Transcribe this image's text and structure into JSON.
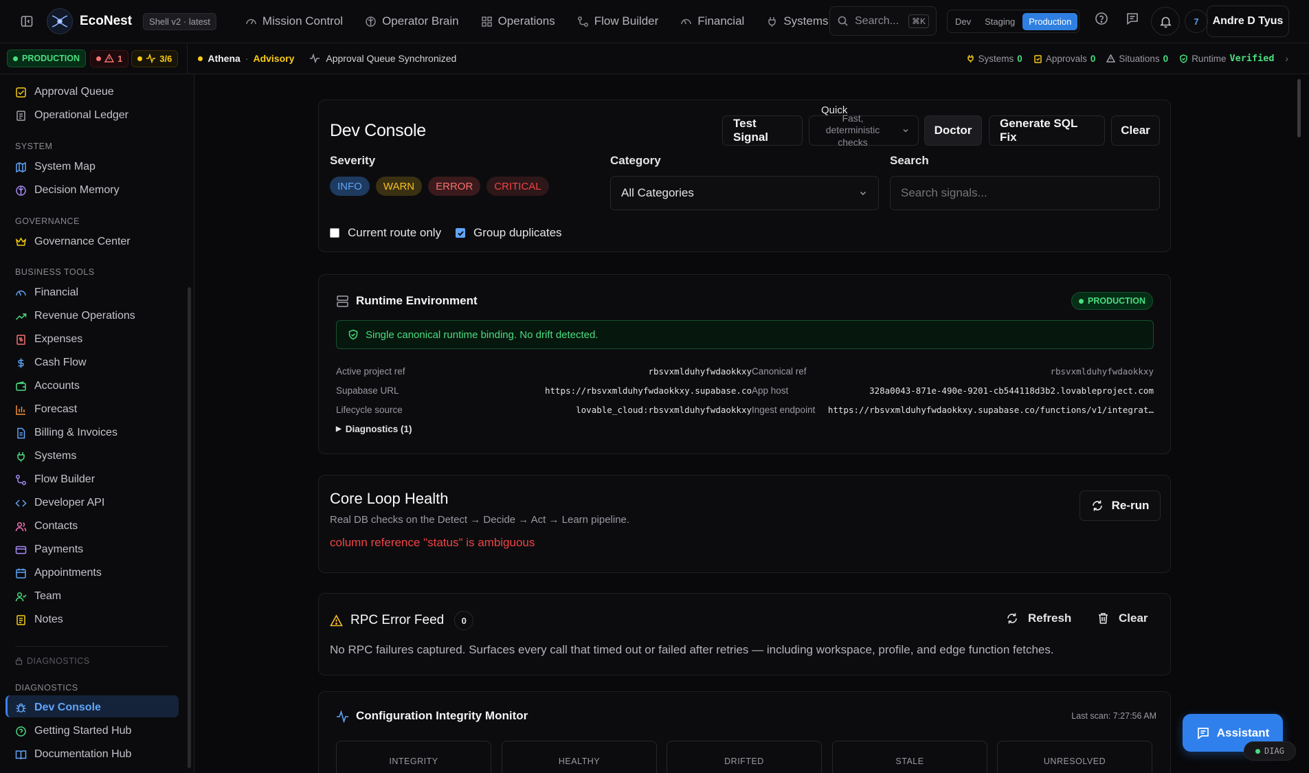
{
  "topbar": {
    "brand": "EcoNest",
    "shell_tag": "Shell v2 · latest",
    "nav": [
      {
        "label": "Mission Control",
        "icon": "gauge-icon"
      },
      {
        "label": "Operator Brain",
        "icon": "brain-icon"
      },
      {
        "label": "Operations",
        "icon": "grid-icon"
      },
      {
        "label": "Flow Builder",
        "icon": "flow-icon"
      },
      {
        "label": "Financial",
        "icon": "gauge-icon"
      },
      {
        "label": "Systems",
        "icon": "plug-icon"
      }
    ],
    "search_placeholder": "Search...",
    "search_shortcut": "⌘K",
    "envs": [
      "Dev",
      "Staging",
      "Production"
    ],
    "active_env": "Production",
    "notification_count": "7",
    "user": "Andre D Tyus"
  },
  "subbar": {
    "env_label": "PRODUCTION",
    "alert_count": "1",
    "pulse": "3/6",
    "agent": "Athena",
    "agent_mode": "Advisory",
    "sync_message": "Approval Queue Synchronized",
    "stats": [
      {
        "label": "Systems",
        "value": "0"
      },
      {
        "label": "Approvals",
        "value": "0"
      },
      {
        "label": "Situations",
        "value": "0"
      },
      {
        "label": "Runtime",
        "value": "Verified"
      }
    ]
  },
  "sidebar": {
    "top_items": [
      "Approval Queue",
      "Operational Ledger"
    ],
    "system_label": "SYSTEM",
    "system_items": [
      "System Map",
      "Decision Memory"
    ],
    "governance_label": "GOVERNANCE",
    "governance_items": [
      "Governance Center"
    ],
    "business_label": "BUSINESS TOOLS",
    "business_items": [
      "Financial",
      "Revenue Operations",
      "Expenses",
      "Cash Flow",
      "Accounts",
      "Forecast",
      "Billing & Invoices",
      "Systems",
      "Flow Builder",
      "Developer API",
      "Contacts",
      "Payments",
      "Appointments",
      "Team",
      "Notes"
    ],
    "locked_label": "DIAGNOSTICS",
    "diagnostics_label": "DIAGNOSTICS",
    "diagnostics_items": [
      "Dev Console",
      "Getting Started Hub",
      "Documentation Hub"
    ],
    "active": "Dev Console"
  },
  "console": {
    "title": "Dev Console",
    "test_signal": "Test Signal",
    "mode_label": "Quick",
    "mode_desc": "Fast, deterministic checks",
    "doctor": "Doctor",
    "sql_fix": "Generate SQL Fix",
    "clear": "Clear",
    "severity_label": "Severity",
    "severities": [
      "INFO",
      "WARN",
      "ERROR",
      "CRITICAL"
    ],
    "category_label": "Category",
    "category_value": "All Categories",
    "search_label": "Search",
    "search_placeholder": "Search signals...",
    "current_route": "Current route only",
    "group_duplicates": "Group duplicates",
    "current_route_checked": false,
    "group_duplicates_checked": true
  },
  "runtime": {
    "title": "Runtime Environment",
    "badge": "PRODUCTION",
    "notice": "Single canonical runtime binding. No drift detected.",
    "rows": [
      {
        "k1": "Active project ref",
        "v1": "rbsvxmlduhyfwdaokkxy",
        "k2": "Canonical ref",
        "v2": "rbsvxmlduhyfwdaokkxy"
      },
      {
        "k1": "Supabase URL",
        "v1": "https://rbsvxmlduhyfwdaokkxy.supabase.co",
        "k2": "App host",
        "v2": "328a0043-871e-490e-9201-cb544118d3b2.lovableproject.com"
      },
      {
        "k1": "Lifecycle source",
        "v1": "lovable_cloud:rbsvxmlduhyfwdaokkxy",
        "k2": "Ingest endpoint",
        "v2": "https://rbsvxmlduhyfwdaokkxy.supabase.co/functions/v1/integrat…"
      }
    ],
    "diagnostics": "Diagnostics (1)"
  },
  "core_loop": {
    "title": "Core Loop Health",
    "desc": "Real DB checks on the Detect → Decide → Act → Learn pipeline.",
    "error": "column reference \"status\" is ambiguous",
    "rerun": "Re-run"
  },
  "rpc": {
    "title": "RPC Error Feed",
    "count": "0",
    "refresh": "Refresh",
    "clear": "Clear",
    "message": "No RPC failures captured. Surfaces every call that timed out or failed after retries — including workspace, profile, and edge function fetches."
  },
  "integrity": {
    "title": "Configuration Integrity Monitor",
    "last_scan": "Last scan: 7:27:56 AM",
    "boxes": [
      "INTEGRITY",
      "HEALTHY",
      "DRIFTED",
      "STALE",
      "UNRESOLVED"
    ]
  },
  "assistant": "Assistant",
  "diag_chip": "DIAG",
  "colors": {
    "accent": "#2f80ed",
    "ok": "#4ade80",
    "warn": "#facc15",
    "error": "#f87171"
  }
}
